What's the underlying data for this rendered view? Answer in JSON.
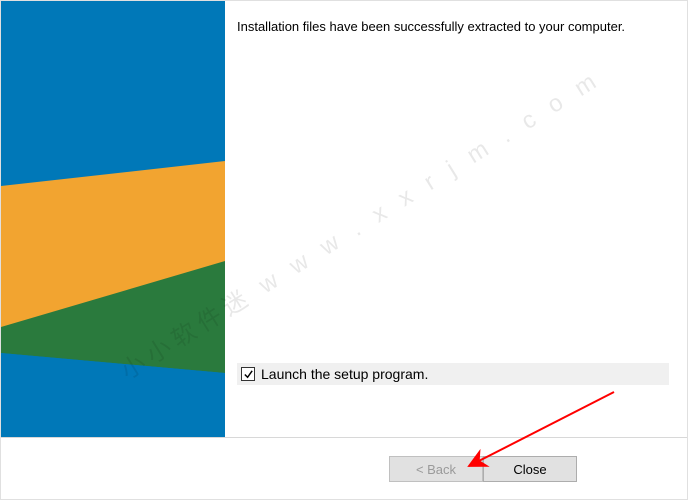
{
  "content": {
    "message": "Installation files have been successfully extracted to your computer."
  },
  "options": {
    "launch_checked": true,
    "launch_label": "Launch the setup program."
  },
  "buttons": {
    "back": "< Back",
    "close": "Close"
  },
  "watermark": "小小软件迷   w w w . x x r j m . c o m"
}
